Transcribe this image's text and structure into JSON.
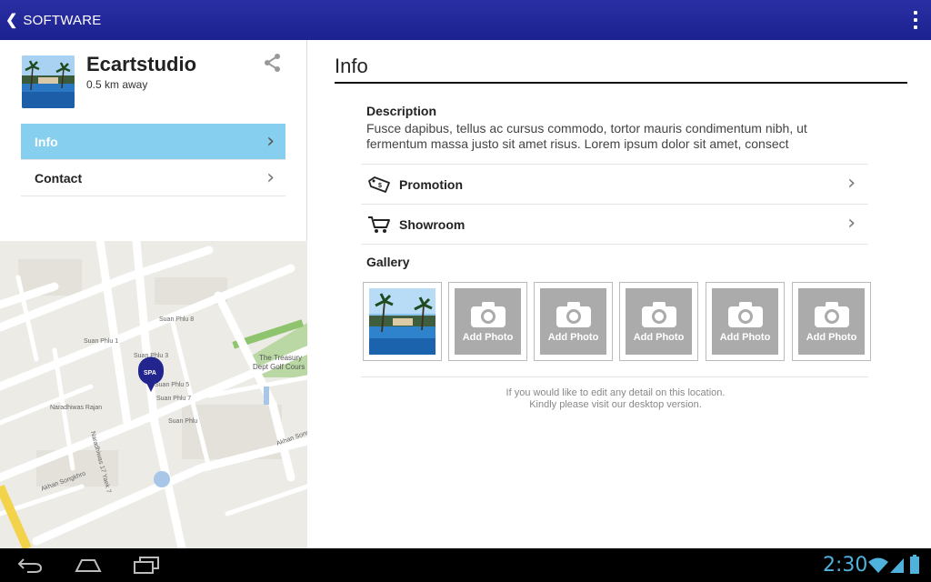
{
  "actionbar": {
    "back_label": "SOFTWARE"
  },
  "business": {
    "name": "Ecartstudio",
    "distance": "0.5 km away"
  },
  "menu": {
    "items": [
      {
        "label": "Info",
        "active": true
      },
      {
        "label": "Contact",
        "active": false
      }
    ]
  },
  "map": {
    "labels": {
      "soi_phiu_1": "Suan Phlu 1",
      "soi_phiu_3": "Suan Phlu 3",
      "soi_phiu_5": "Suan Phlu 5",
      "soi_phiu_7": "Suan Phlu 7",
      "soi_phiu_8": "Suan Phlu 8",
      "soi_phiu": "Suan Phlu",
      "naradhiwas": "Naradhiwas Rajan",
      "narathiwat_17": "Naradhiwas 17 Yaek 7",
      "akhan": "Akhan Songkhro",
      "akhan2": "Akhan Songkh",
      "treasury1": "The Treasury",
      "treasury2": "Dept Golf Cours",
      "pin": "SPA"
    }
  },
  "info": {
    "title": "Info",
    "description_label": "Description",
    "description_text": "Fusce dapibus, tellus ac cursus commodo, tortor mauris condimentum nibh, ut fermentum massa justo sit amet risus. Lorem ipsum dolor sit amet, consect",
    "rows": [
      {
        "label": "Promotion",
        "icon": "tag-icon"
      },
      {
        "label": "Showroom",
        "icon": "cart-icon"
      }
    ],
    "gallery_label": "Gallery",
    "add_photo": "Add Photo",
    "note_line1": "If you would like to edit any detail on this location.",
    "note_line2": "Kindly please visit our desktop version."
  },
  "statusbar": {
    "time": "2:30"
  },
  "colors": {
    "actionbar": "#1f2494",
    "menu_active": "#87cfee",
    "clock": "#4fb2dc"
  }
}
